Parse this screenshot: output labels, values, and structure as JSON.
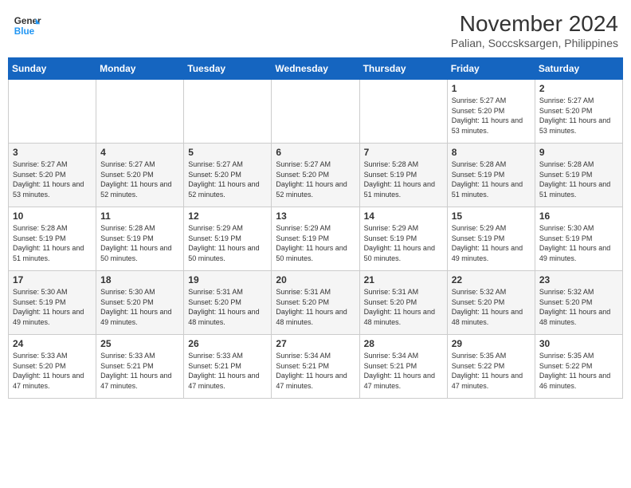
{
  "header": {
    "logo_line1": "General",
    "logo_line2": "Blue",
    "title": "November 2024",
    "subtitle": "Palian, Soccsksargen, Philippines"
  },
  "weekdays": [
    "Sunday",
    "Monday",
    "Tuesday",
    "Wednesday",
    "Thursday",
    "Friday",
    "Saturday"
  ],
  "weeks": [
    [
      {
        "day": "",
        "info": ""
      },
      {
        "day": "",
        "info": ""
      },
      {
        "day": "",
        "info": ""
      },
      {
        "day": "",
        "info": ""
      },
      {
        "day": "",
        "info": ""
      },
      {
        "day": "1",
        "info": "Sunrise: 5:27 AM\nSunset: 5:20 PM\nDaylight: 11 hours and 53 minutes."
      },
      {
        "day": "2",
        "info": "Sunrise: 5:27 AM\nSunset: 5:20 PM\nDaylight: 11 hours and 53 minutes."
      }
    ],
    [
      {
        "day": "3",
        "info": "Sunrise: 5:27 AM\nSunset: 5:20 PM\nDaylight: 11 hours and 53 minutes."
      },
      {
        "day": "4",
        "info": "Sunrise: 5:27 AM\nSunset: 5:20 PM\nDaylight: 11 hours and 52 minutes."
      },
      {
        "day": "5",
        "info": "Sunrise: 5:27 AM\nSunset: 5:20 PM\nDaylight: 11 hours and 52 minutes."
      },
      {
        "day": "6",
        "info": "Sunrise: 5:27 AM\nSunset: 5:20 PM\nDaylight: 11 hours and 52 minutes."
      },
      {
        "day": "7",
        "info": "Sunrise: 5:28 AM\nSunset: 5:19 PM\nDaylight: 11 hours and 51 minutes."
      },
      {
        "day": "8",
        "info": "Sunrise: 5:28 AM\nSunset: 5:19 PM\nDaylight: 11 hours and 51 minutes."
      },
      {
        "day": "9",
        "info": "Sunrise: 5:28 AM\nSunset: 5:19 PM\nDaylight: 11 hours and 51 minutes."
      }
    ],
    [
      {
        "day": "10",
        "info": "Sunrise: 5:28 AM\nSunset: 5:19 PM\nDaylight: 11 hours and 51 minutes."
      },
      {
        "day": "11",
        "info": "Sunrise: 5:28 AM\nSunset: 5:19 PM\nDaylight: 11 hours and 50 minutes."
      },
      {
        "day": "12",
        "info": "Sunrise: 5:29 AM\nSunset: 5:19 PM\nDaylight: 11 hours and 50 minutes."
      },
      {
        "day": "13",
        "info": "Sunrise: 5:29 AM\nSunset: 5:19 PM\nDaylight: 11 hours and 50 minutes."
      },
      {
        "day": "14",
        "info": "Sunrise: 5:29 AM\nSunset: 5:19 PM\nDaylight: 11 hours and 50 minutes."
      },
      {
        "day": "15",
        "info": "Sunrise: 5:29 AM\nSunset: 5:19 PM\nDaylight: 11 hours and 49 minutes."
      },
      {
        "day": "16",
        "info": "Sunrise: 5:30 AM\nSunset: 5:19 PM\nDaylight: 11 hours and 49 minutes."
      }
    ],
    [
      {
        "day": "17",
        "info": "Sunrise: 5:30 AM\nSunset: 5:19 PM\nDaylight: 11 hours and 49 minutes."
      },
      {
        "day": "18",
        "info": "Sunrise: 5:30 AM\nSunset: 5:20 PM\nDaylight: 11 hours and 49 minutes."
      },
      {
        "day": "19",
        "info": "Sunrise: 5:31 AM\nSunset: 5:20 PM\nDaylight: 11 hours and 48 minutes."
      },
      {
        "day": "20",
        "info": "Sunrise: 5:31 AM\nSunset: 5:20 PM\nDaylight: 11 hours and 48 minutes."
      },
      {
        "day": "21",
        "info": "Sunrise: 5:31 AM\nSunset: 5:20 PM\nDaylight: 11 hours and 48 minutes."
      },
      {
        "day": "22",
        "info": "Sunrise: 5:32 AM\nSunset: 5:20 PM\nDaylight: 11 hours and 48 minutes."
      },
      {
        "day": "23",
        "info": "Sunrise: 5:32 AM\nSunset: 5:20 PM\nDaylight: 11 hours and 48 minutes."
      }
    ],
    [
      {
        "day": "24",
        "info": "Sunrise: 5:33 AM\nSunset: 5:20 PM\nDaylight: 11 hours and 47 minutes."
      },
      {
        "day": "25",
        "info": "Sunrise: 5:33 AM\nSunset: 5:21 PM\nDaylight: 11 hours and 47 minutes."
      },
      {
        "day": "26",
        "info": "Sunrise: 5:33 AM\nSunset: 5:21 PM\nDaylight: 11 hours and 47 minutes."
      },
      {
        "day": "27",
        "info": "Sunrise: 5:34 AM\nSunset: 5:21 PM\nDaylight: 11 hours and 47 minutes."
      },
      {
        "day": "28",
        "info": "Sunrise: 5:34 AM\nSunset: 5:21 PM\nDaylight: 11 hours and 47 minutes."
      },
      {
        "day": "29",
        "info": "Sunrise: 5:35 AM\nSunset: 5:22 PM\nDaylight: 11 hours and 47 minutes."
      },
      {
        "day": "30",
        "info": "Sunrise: 5:35 AM\nSunset: 5:22 PM\nDaylight: 11 hours and 46 minutes."
      }
    ]
  ]
}
